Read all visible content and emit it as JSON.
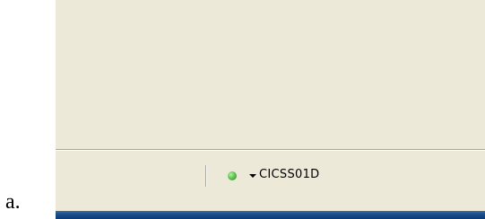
{
  "caption": {
    "label": "a."
  },
  "status_bar": {
    "connection_name": "CICSS01D",
    "status_indicator": {
      "icon": "green-status-light",
      "color": "#5bbf4c"
    },
    "dropdown_icon": "dropdown-arrow-icon"
  },
  "colors": {
    "window_background": "#ece9d8",
    "taskbar": "#0a3a78"
  }
}
